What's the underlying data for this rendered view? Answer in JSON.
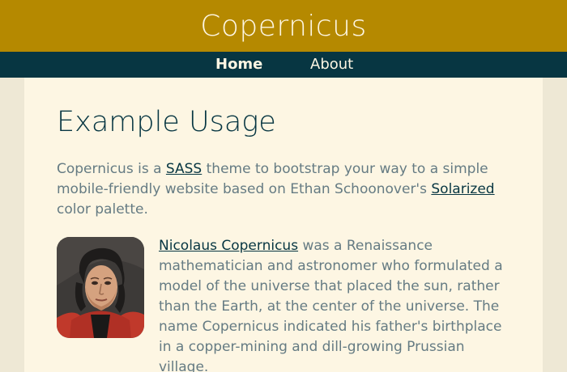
{
  "header": {
    "title": "Copernicus"
  },
  "nav": {
    "items": [
      {
        "label": "Home",
        "active": true
      },
      {
        "label": "About",
        "active": false
      }
    ]
  },
  "main": {
    "heading": "Example Usage",
    "intro": {
      "t1": "Copernicus is a ",
      "link1": "SASS",
      "t2": " theme to bootstrap your way to a simple mobile-friendly website based on Ethan Schoonover's ",
      "link2": "Solarized",
      "t3": " color palette."
    },
    "bio": {
      "link": "Nicolaus Copernicus",
      "text": " was a Renaissance mathematician and astronomer who formulated a model of the universe that placed the sun, rather than the Earth, at the center of the universe. The name Copernicus indicated his father's birthplace in a copper-mining and dill-growing Prussian village."
    },
    "portrait_icon": "portrait-image"
  },
  "colors": {
    "header_bg": "#b58900",
    "nav_bg": "#073642",
    "content_bg": "#fdf6e3",
    "page_bg": "#eee8d5",
    "text": "#657b83",
    "heading": "#073642"
  }
}
